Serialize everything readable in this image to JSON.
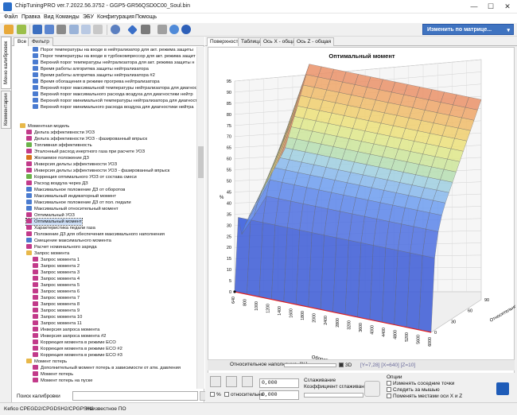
{
  "window": {
    "title": "ChipTuningPRO ver.7.2022.56.3752 - GGP5-GR56QSD0C00_Soul.bin",
    "min": "—",
    "max": "☐",
    "close": "✕"
  },
  "menu": [
    "Файл",
    "Правка",
    "Вид",
    "Команды",
    "ЭБУ",
    "Конфигурация",
    "Помощь"
  ],
  "toolbar": {
    "matrix_button": "Изменить по матрице...",
    "matrix_arrow": "▾"
  },
  "side_tabs": [
    "Меню калибровок",
    "Комментарии"
  ],
  "panel_tabs": [
    "Все",
    "Фильтр"
  ],
  "tree": [
    {
      "label": "Порог температуры на входе в нейтрализатор для акт. режима защиты",
      "level": 2,
      "color": "#4a7bd0"
    },
    {
      "label": "Порог температуры на входе в турбокомпрессор для акт. режима защит",
      "level": 2,
      "color": "#4a7bd0"
    },
    {
      "label": "Верхний порог температуры нейтрализатора для акт. режима защиты н",
      "level": 2,
      "color": "#4a7bd0"
    },
    {
      "label": "Время работы алгоритма защиты нейтрализатора",
      "level": 2,
      "color": "#4a7bd0"
    },
    {
      "label": "Время работы алгоритма защиты нейтрализатора #2",
      "level": 2,
      "color": "#4a7bd0"
    },
    {
      "label": "Время обогащения в режиме прогрева нейтрализатора",
      "level": 2,
      "color": "#4a7bd0"
    },
    {
      "label": "Верхний порог максимальной температуры нейтрализатора для диагност",
      "level": 2,
      "color": "#4a7bd0"
    },
    {
      "label": "Верхний порог максимального расхода воздуха для диагностики нейтр",
      "level": 2,
      "color": "#4a7bd0"
    },
    {
      "label": "Верхний порог минимальной температуры нейтрализатора для диагност",
      "level": 2,
      "color": "#4a7bd0"
    },
    {
      "label": "Верхний порог минимального расхода воздуха для диагностики нейтра",
      "level": 2,
      "color": "#4a7bd0"
    },
    {
      "label": "",
      "level": 2,
      "color": ""
    },
    {
      "label": "",
      "level": 2,
      "color": ""
    },
    {
      "label": "Моментная модель",
      "level": 0,
      "color": "#e8b84a",
      "folder": true
    },
    {
      "label": "Дельта эффективности УОЗ",
      "level": 1,
      "color": "#c23a8a"
    },
    {
      "label": "Дельта эффективности УОЗ - фазированный впрыск",
      "level": 1,
      "color": "#c23a8a"
    },
    {
      "label": "Топливная эффективность",
      "level": 1,
      "color": "#6bb24a"
    },
    {
      "label": "Эталонный расход инертного газа при расчете УОЗ",
      "level": 1,
      "color": "#c23a8a"
    },
    {
      "label": "Желаемое положение ДЗ",
      "level": 1,
      "color": "#d9731d"
    },
    {
      "label": "Инверсия дельты эффективности УОЗ",
      "level": 1,
      "color": "#c23a8a"
    },
    {
      "label": "Инверсия дельты эффективности УОЗ - фазированный впрыск",
      "level": 1,
      "color": "#c23a8a"
    },
    {
      "label": "Коррекция оптимального УОЗ от состава смеси",
      "level": 1,
      "color": "#6bb24a"
    },
    {
      "label": "Расход воздуха через ДЗ",
      "level": 1,
      "color": "#c23a8a"
    },
    {
      "label": "Максимальное положение ДЗ от оборотов",
      "level": 1,
      "color": "#4a7bd0"
    },
    {
      "label": "Максимальный индикаторный момент",
      "level": 1,
      "color": "#4a7bd0"
    },
    {
      "label": "Максимальное положение ДЗ от пол. педали",
      "level": 1,
      "color": "#4a7bd0"
    },
    {
      "label": "Максимальный относительный момент",
      "level": 1,
      "color": "#4a7bd0"
    },
    {
      "label": "Оптимальный УОЗ",
      "level": 1,
      "color": "#c23a8a"
    },
    {
      "label": "Оптимальный момент",
      "level": 1,
      "color": "#c23a8a",
      "selected": true
    },
    {
      "label": "Характеристика педали газа",
      "level": 1,
      "color": "#c23a8a"
    },
    {
      "label": "Положение ДЗ для обеспечения максимального наполнения",
      "level": 1,
      "color": "#c23a8a"
    },
    {
      "label": "Смещение максимального момента",
      "level": 1,
      "color": "#4a7bd0"
    },
    {
      "label": "Расчет номинального заряда",
      "level": 1,
      "color": "#c23a8a"
    },
    {
      "label": "Запрос момента",
      "level": 1,
      "color": "#e8b84a",
      "folder": true
    },
    {
      "label": "Запрос момента 1",
      "level": 2,
      "color": "#c23a8a"
    },
    {
      "label": "Запрос момента 2",
      "level": 2,
      "color": "#c23a8a"
    },
    {
      "label": "Запрос момента 3",
      "level": 2,
      "color": "#c23a8a"
    },
    {
      "label": "Запрос момента 4",
      "level": 2,
      "color": "#c23a8a"
    },
    {
      "label": "Запрос момента 5",
      "level": 2,
      "color": "#c23a8a"
    },
    {
      "label": "Запрос момента 6",
      "level": 2,
      "color": "#c23a8a"
    },
    {
      "label": "Запрос момента 7",
      "level": 2,
      "color": "#c23a8a"
    },
    {
      "label": "Запрос момента 8",
      "level": 2,
      "color": "#c23a8a"
    },
    {
      "label": "Запрос момента 9",
      "level": 2,
      "color": "#c23a8a"
    },
    {
      "label": "Запрос момента 10",
      "level": 2,
      "color": "#c23a8a"
    },
    {
      "label": "Запрос момента 11",
      "level": 2,
      "color": "#c23a8a"
    },
    {
      "label": "Инверсия запроса момента",
      "level": 2,
      "color": "#c23a8a"
    },
    {
      "label": "Инверсия запроса момента #2",
      "level": 2,
      "color": "#c23a8a"
    },
    {
      "label": "Коррекция момента в режиме ECO",
      "level": 2,
      "color": "#c23a8a"
    },
    {
      "label": "Коррекция момента в режиме ECO #2",
      "level": 2,
      "color": "#c23a8a"
    },
    {
      "label": "Коррекция момента в режиме ECO #3",
      "level": 2,
      "color": "#c23a8a"
    },
    {
      "label": "Момент потерь",
      "level": 1,
      "color": "#e8b84a",
      "folder": true
    },
    {
      "label": "Дополнительный момент потерь в зависимости от атм. давления",
      "level": 2,
      "color": "#c23a8a"
    },
    {
      "label": "Момент потерь",
      "level": 2,
      "color": "#c23a8a"
    },
    {
      "label": "Момент потерь на пуске",
      "level": 2,
      "color": "#c23a8a"
    }
  ],
  "search": {
    "label": "Поиск калибровки"
  },
  "view_tabs": [
    "Поверхность",
    "Таблица",
    "Ось X - общая",
    "Ось Z - общая"
  ],
  "chart_data": {
    "type": "surface",
    "title": "Оптимальный момент",
    "xlabel": "Обороты, [rpm]",
    "ylabel": "%",
    "zlabel": "Относительное",
    "x_ticks": [
      "640",
      "800",
      "1000",
      "1200",
      "1400",
      "1600",
      "1800",
      "2000",
      "2400",
      "2800",
      "3200",
      "3600",
      "4000",
      "4400",
      "4800",
      "5200",
      "5600",
      "6000"
    ],
    "y_ticks": [
      "0",
      "5",
      "10",
      "15",
      "20",
      "25",
      "30",
      "35",
      "40",
      "45",
      "50",
      "55",
      "60",
      "65",
      "70",
      "75",
      "80",
      "85",
      "90",
      "95"
    ],
    "z_ticks": [
      "0",
      "30",
      "60",
      "90"
    ],
    "ylim": [
      0,
      95
    ],
    "surface_levels": [
      0.0,
      0.36,
      0.48,
      0.55,
      0.6,
      0.64,
      0.68,
      0.72,
      0.76,
      0.8,
      0.84,
      0.88,
      0.92,
      0.96,
      1.0
    ]
  },
  "bottom": {
    "fill_label": "Относительное наполнение, [%]",
    "checkbox_3d": "3D",
    "coords": "[Y=7,28]  [X=640]  [Z=10]"
  },
  "controls": {
    "value1": "0,000",
    "value2": "0,000",
    "pct": "%",
    "rel": "относительно",
    "smooth_title": "Сглаживание",
    "smooth_coef": "Коэффициент сглаживания",
    "options_title": "Опции",
    "opt1": "Изменять соседние точки",
    "opt2": "Следить за мышью",
    "opt3": "Поменять местами оси X и Z"
  },
  "status": {
    "left": "Kefico CPEGD2/CPGDSH2/CPGPSH2",
    "right": "Неизвестное ПО"
  }
}
